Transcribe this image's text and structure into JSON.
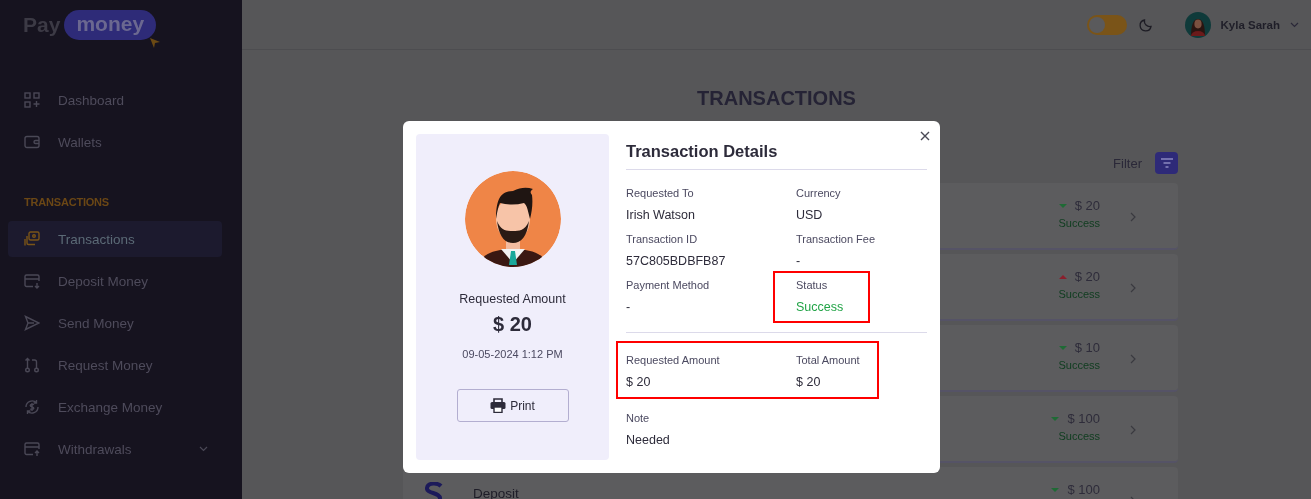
{
  "brand": {
    "word": "Pay",
    "badge": "money"
  },
  "sidebar": {
    "groups": [
      {
        "items": [
          {
            "label": "Dashboard",
            "kind": "link",
            "selected": false
          },
          {
            "label": "Wallets",
            "kind": "link",
            "selected": false
          }
        ]
      },
      {
        "heading": "TRANSACTIONS",
        "items": [
          {
            "label": "Transactions",
            "kind": "link",
            "selected": true
          },
          {
            "label": "Deposit Money",
            "kind": "link",
            "selected": false
          },
          {
            "label": "Send Money",
            "kind": "link",
            "selected": false
          },
          {
            "label": "Request Money",
            "kind": "link",
            "selected": false
          },
          {
            "label": "Exchange Money",
            "kind": "link",
            "selected": false
          },
          {
            "label": "Withdrawals",
            "kind": "dropdown",
            "selected": false
          }
        ]
      }
    ]
  },
  "header": {
    "theme_toggle": {
      "on": false
    },
    "user": {
      "name": "Kyla Sarah"
    }
  },
  "page": {
    "title": "TRANSACTIONS",
    "filter": {
      "label": "Filter"
    },
    "transactions": [
      {
        "kind": "down",
        "amount": "$ 20",
        "status": "Success"
      },
      {
        "kind": "up",
        "amount": "$ 20",
        "status": "Success"
      },
      {
        "kind": "down",
        "amount": "$ 10",
        "status": "Success"
      },
      {
        "kind": "down",
        "amount": "$ 100",
        "status": "Success"
      },
      {
        "title": "Deposit",
        "kind": "down",
        "amount": "$ 100"
      }
    ]
  },
  "modal": {
    "summary": {
      "label": "Requested Amount",
      "amount": "$ 20",
      "date": "09-05-2024 1:12 PM",
      "print": "Print"
    },
    "title": "Transaction Details",
    "fields": [
      {
        "label": "Requested To",
        "value": "Irish Watson",
        "kind": "text",
        "highlighted": false
      },
      {
        "label": "Currency",
        "value": "USD",
        "kind": "text",
        "highlighted": false
      },
      {
        "label": "Transaction ID",
        "value": "57C805BDBFB87",
        "kind": "text",
        "highlighted": false
      },
      {
        "label": "Transaction Fee",
        "value": "-",
        "kind": "text",
        "highlighted": false
      },
      {
        "label": "Payment Method",
        "value": "-",
        "kind": "text",
        "highlighted": false
      },
      {
        "label": "Status",
        "value": "Success",
        "kind": "status",
        "highlighted": true
      }
    ],
    "amounts": {
      "highlighted": true,
      "items": [
        {
          "label": "Requested Amount",
          "value": "$ 20"
        },
        {
          "label": "Total Amount",
          "value": "$ 20"
        }
      ]
    },
    "note": {
      "label": "Note",
      "value": "Needed"
    }
  }
}
